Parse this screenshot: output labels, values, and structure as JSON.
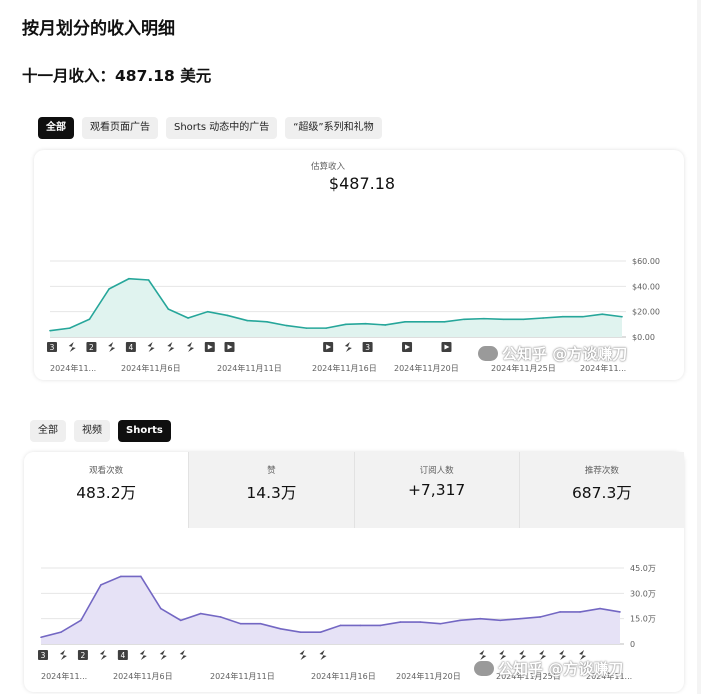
{
  "page_title": "按月划分的收入明细",
  "subtitle": "十一月收入：487.18 美元",
  "revenue_tabs": [
    {
      "label": "全部",
      "active": true
    },
    {
      "label": "观看页面广告",
      "active": false
    },
    {
      "label": "Shorts 动态中的广告",
      "active": false
    },
    {
      "label": "“超级”系列和礼物",
      "active": false
    }
  ],
  "revenue_card": {
    "label": "估算收入",
    "value": "$487.18"
  },
  "content_tabs": [
    {
      "label": "全部",
      "active": false
    },
    {
      "label": "视频",
      "active": false
    },
    {
      "label": "Shorts",
      "active": true
    }
  ],
  "metrics": [
    {
      "label": "观看次数",
      "value": "483.2万",
      "active": true
    },
    {
      "label": "赞",
      "value": "14.3万",
      "active": false
    },
    {
      "label": "订阅人数",
      "value": "+7,317",
      "active": false
    },
    {
      "label": "推荐次数",
      "value": "687.3万",
      "active": false
    }
  ],
  "watermark": "公知乎 @方谈赚刀",
  "colors": {
    "revenue_line": "#26a69a",
    "revenue_fill": "#e0f3ef",
    "views_line": "#7367c3",
    "views_fill": "#e6e2f6",
    "active_chip": "#0f0f0f"
  },
  "chart_data": [
    {
      "type": "area",
      "title": "估算收入",
      "x_ticks": [
        "2024年11...",
        "2024年11月6日",
        "2024年11月11日",
        "2024年11月16日",
        "2024年11月20日",
        "2024年11月25日",
        "2024年11..."
      ],
      "y_ticks": [
        "$0.00",
        "$20.00",
        "$40.00",
        "$60.00"
      ],
      "ylim": [
        0,
        60
      ],
      "x": [
        1,
        2,
        3,
        4,
        5,
        6,
        7,
        8,
        9,
        10,
        11,
        12,
        13,
        14,
        15,
        16,
        17,
        18,
        19,
        20,
        21,
        22,
        23,
        24,
        25,
        26,
        27,
        28,
        29,
        30
      ],
      "values": [
        5,
        7,
        14,
        38,
        46,
        45,
        22,
        15,
        20,
        17,
        13,
        12,
        9,
        7,
        7,
        10,
        10.5,
        9.5,
        12,
        12,
        12,
        14,
        14.5,
        14,
        14,
        15,
        16,
        16,
        18,
        16
      ],
      "markers": [
        "num:3",
        "short",
        "num:2",
        "short",
        "num:4",
        "short",
        "short",
        "short",
        "video",
        "video",
        "",
        "",
        "",
        "",
        "video",
        "short",
        "num:3",
        "",
        "video",
        "",
        "video",
        "",
        "",
        "",
        "",
        "",
        "",
        "",
        "",
        ""
      ]
    },
    {
      "type": "area",
      "title": "观看次数",
      "x_ticks": [
        "2024年11...",
        "2024年11月6日",
        "2024年11月11日",
        "2024年11月16日",
        "2024年11月20日",
        "2024年11月25日",
        "2024年11..."
      ],
      "y_ticks": [
        "0",
        "15.0万",
        "30.0万",
        "45.0万"
      ],
      "ylim": [
        0,
        45
      ],
      "x": [
        1,
        2,
        3,
        4,
        5,
        6,
        7,
        8,
        9,
        10,
        11,
        12,
        13,
        14,
        15,
        16,
        17,
        18,
        19,
        20,
        21,
        22,
        23,
        24,
        25,
        26,
        27,
        28,
        29,
        30
      ],
      "values": [
        4,
        7,
        14,
        35,
        40,
        40,
        21,
        14,
        18,
        16,
        12,
        12,
        9,
        7,
        7,
        11,
        11,
        11,
        13,
        13,
        12,
        14,
        15,
        14,
        15,
        16,
        19,
        19,
        21,
        19
      ],
      "markers": [
        "num:3",
        "short",
        "num:2",
        "short",
        "num:4",
        "short",
        "short",
        "short",
        "",
        "",
        "",
        "",
        "",
        "short",
        "short",
        "",
        "",
        "",
        "",
        "",
        "",
        "",
        "short",
        "short",
        "short",
        "short",
        "short",
        "short",
        "",
        ""
      ]
    }
  ]
}
